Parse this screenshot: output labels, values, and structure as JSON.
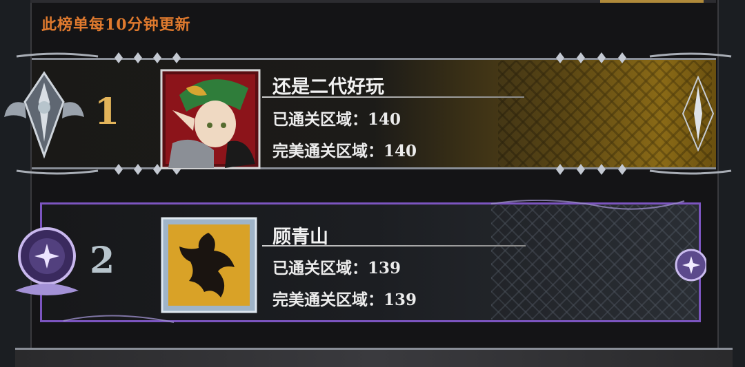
{
  "notice": "此榜单每10分钟更新",
  "entries": [
    {
      "rank": "1",
      "name": "还是二代好玩",
      "cleared_label": "已通关区域：",
      "cleared_value": "140",
      "perfect_label": "完美通关区域：",
      "perfect_value": "140",
      "avatar_icon": "elf-knight-portrait-icon",
      "badge_icon": "winged-sword-badge-icon"
    },
    {
      "rank": "2",
      "name": "顾青山",
      "cleared_label": "已通关区域：",
      "cleared_value": "139",
      "perfect_label": "完美通关区域：",
      "perfect_value": "139",
      "avatar_icon": "black-dragon-emblem-icon",
      "badge_icon": "crescent-moon-badge-icon"
    }
  ],
  "colors": {
    "notice": "#e07a2e",
    "rank1": "#e3b45a",
    "rank2": "#b7c4cc",
    "card1_border": "#8a8f98",
    "card2_border": "#7c55c0",
    "gold_accent": "#8a6a16"
  }
}
